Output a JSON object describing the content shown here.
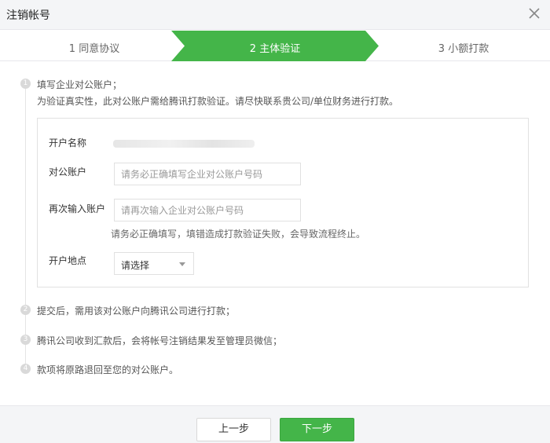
{
  "dialog": {
    "title": "注销帐号"
  },
  "steps": [
    {
      "label": "1 同意协议",
      "active": false
    },
    {
      "label": "2 主体验证",
      "active": true
    },
    {
      "label": "3 小额打款",
      "active": false
    }
  ],
  "colors": {
    "accent": "#44b549",
    "bullet": "#d9d9d9",
    "titlebar": "#f4f5f7"
  },
  "instructions": [
    {
      "num": "1",
      "lines": [
        "填写企业对公账户；",
        "为验证真实性，此对公账户需给腾讯打款验证。请尽快联系贵公司/单位财务进行打款。"
      ]
    },
    {
      "num": "2",
      "lines": [
        "提交后，需用该对公账户向腾讯公司进行打款；"
      ]
    },
    {
      "num": "3",
      "lines": [
        "腾讯公司收到汇款后，会将帐号注销结果发至管理员微信；"
      ]
    },
    {
      "num": "4",
      "lines": [
        "款项将原路退回至您的对公账户。"
      ]
    }
  ],
  "form": {
    "account_name_label": "开户名称",
    "account_label": "对公账户",
    "account_placeholder": "请务必正确填写企业对公账户号码",
    "confirm_label": "再次输入账户",
    "confirm_placeholder": "请再次输入企业对公账户号码",
    "hint": "请务必正确填写，填错造成打款验证失败，会导致流程终止。",
    "location_label": "开户地点",
    "location_value": "请选择"
  },
  "footer": {
    "prev_label": "上一步",
    "next_label": "下一步"
  }
}
